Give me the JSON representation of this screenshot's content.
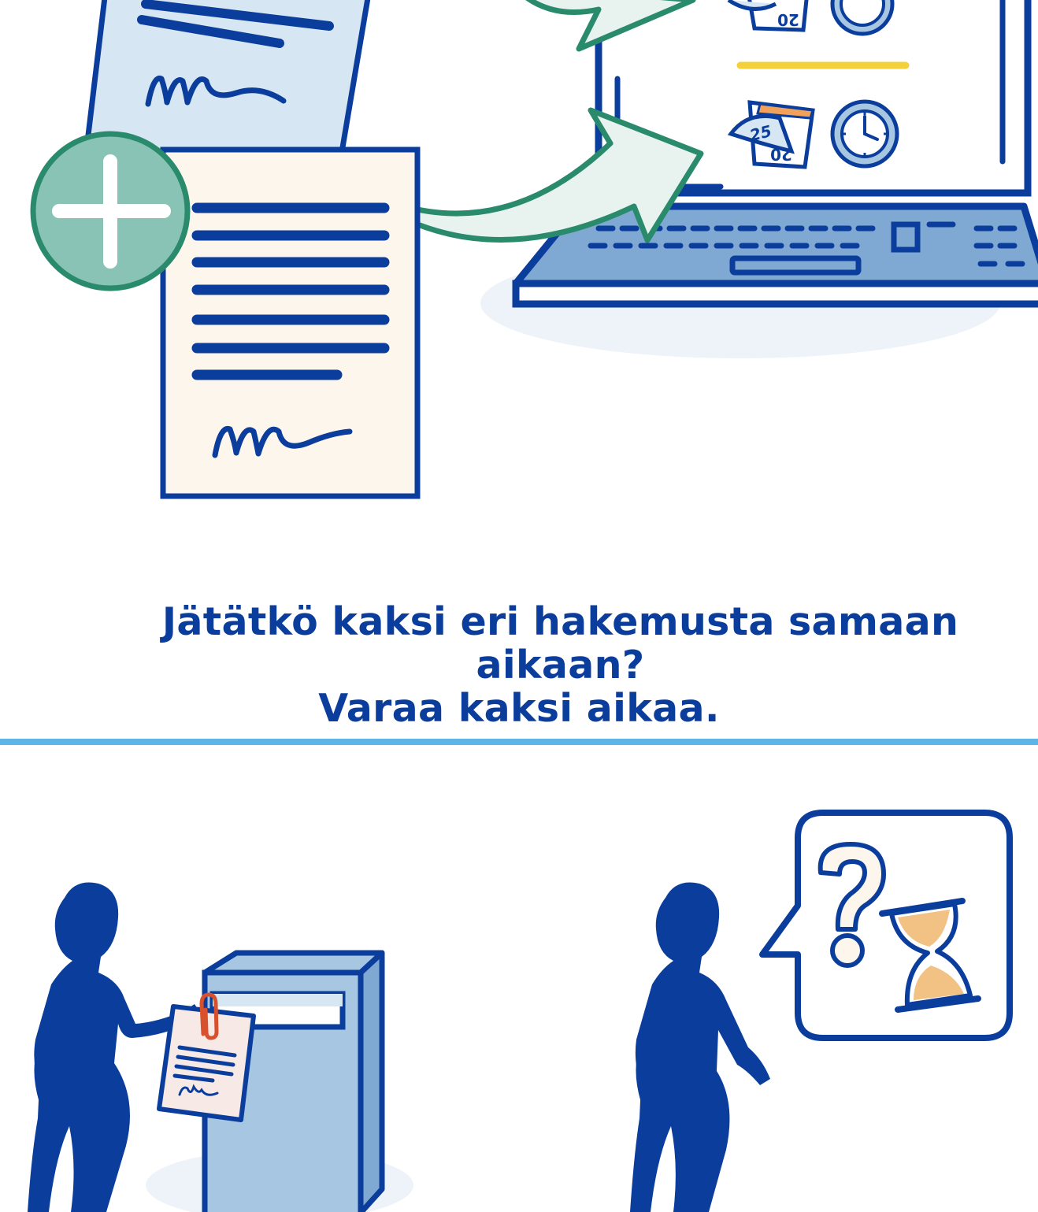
{
  "heading": {
    "line1": "Jätätkö kaksi eri hakemusta samaan aikaan?",
    "line2": "Varaa kaksi aikaa."
  },
  "calendar_top": {
    "number": "20"
  },
  "calendar_bottom": {
    "page_number": "25",
    "number": "20"
  },
  "colors": {
    "navy": "#0a3d9c",
    "light_blue": "#a6c6e2",
    "paper_blue": "#d7e6f3",
    "paper_cream": "#fdf6ec",
    "green": "#2a8a6c",
    "green_fill": "#88c3b6",
    "yellow": "#f4d13b",
    "sand": "#f2c184",
    "clip_red": "#d9512c",
    "divider": "#5eb6e8"
  }
}
